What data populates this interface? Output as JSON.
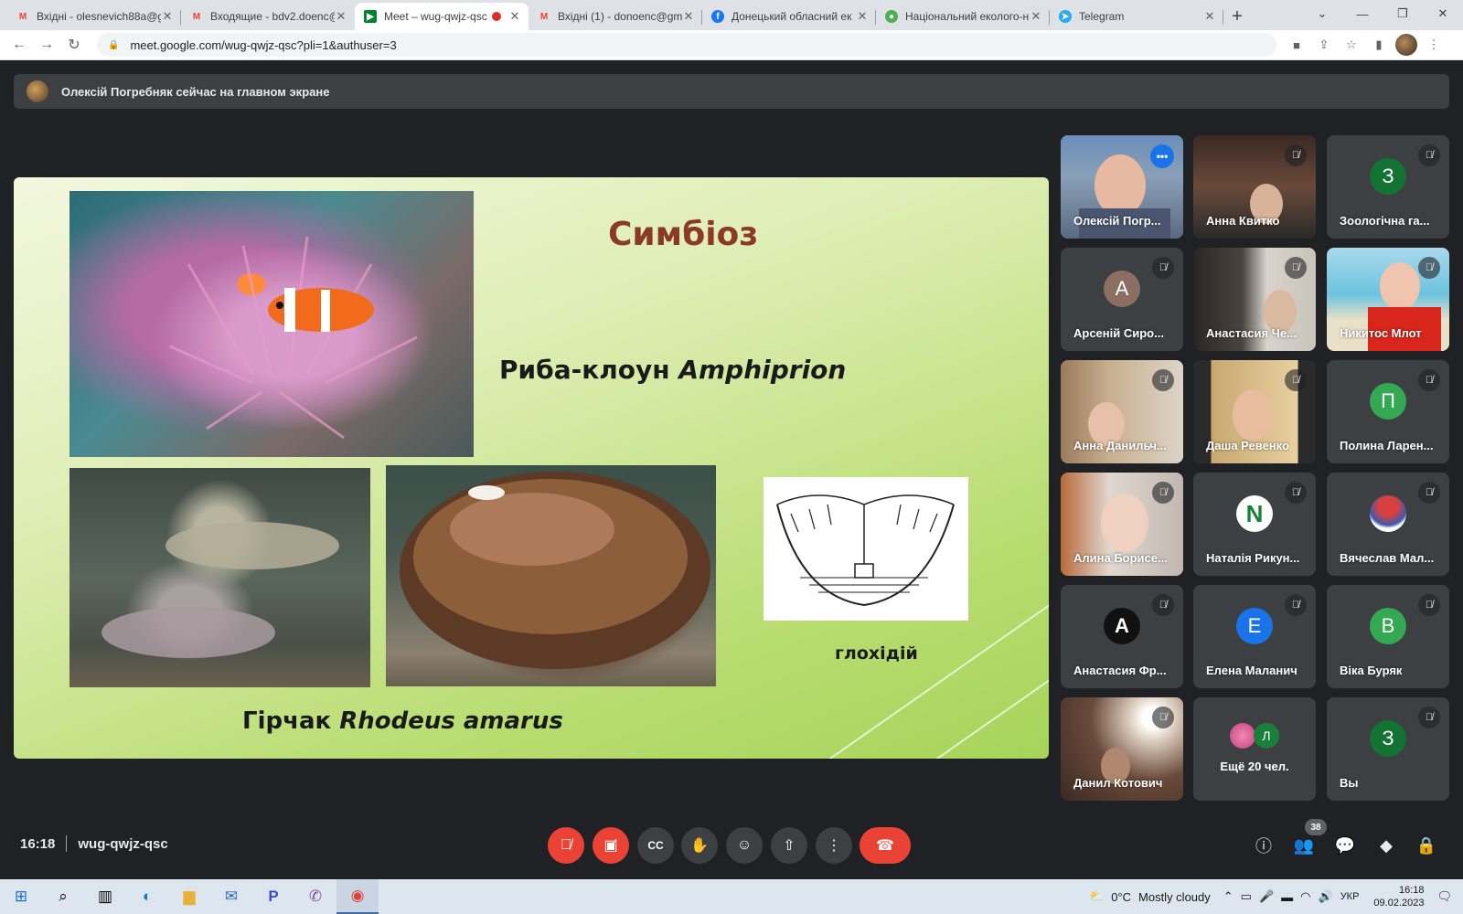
{
  "browser": {
    "tabs": [
      {
        "title": "Вхідні - olesnevich88a@g",
        "icon": "gmail-icon",
        "active": false
      },
      {
        "title": "Входящие - bdv2.doenc@",
        "icon": "gmail-icon",
        "active": false
      },
      {
        "title": "Meet – wug-qwjz-qsc",
        "icon": "meet-icon",
        "active": true
      },
      {
        "title": "Вхідні (1) - donoenc@gm",
        "icon": "gmail-icon",
        "active": false
      },
      {
        "title": "Донецький обласний ек",
        "icon": "facebook-icon",
        "active": false
      },
      {
        "title": "Національний еколого-н",
        "icon": "site-icon",
        "active": false
      },
      {
        "title": "Telegram",
        "icon": "telegram-icon",
        "active": false
      }
    ],
    "url": "meet.google.com/wug-qwjz-qsc?pli=1&authuser=3"
  },
  "meet": {
    "banner": "Олексій Погребняк сейчас на главном экране",
    "slide": {
      "title": "Симбіоз",
      "caption_top_prefix": "Риба-клоун ",
      "caption_top_italic": "Amphiprion",
      "caption_bottom_prefix": "Гірчак ",
      "caption_bottom_italic": "Rhodeus amarus",
      "caption_small": "глохідій"
    },
    "participants": [
      {
        "name": "Олексій Погр...",
        "type": "video",
        "speaking": true
      },
      {
        "name": "Анна Квитко",
        "type": "video",
        "muted": true
      },
      {
        "name": "Зоологічна га...",
        "type": "letter",
        "letter": "З",
        "color": "#137333",
        "muted": true
      },
      {
        "name": "Арсеній Сиро...",
        "type": "letter",
        "letter": "А",
        "color": "#8d6e63",
        "muted": true
      },
      {
        "name": "Анастасия Че...",
        "type": "video",
        "muted": true
      },
      {
        "name": "Никитос Млот",
        "type": "video",
        "muted": true
      },
      {
        "name": "Анна Данильч...",
        "type": "video",
        "muted": true
      },
      {
        "name": "Даша Ревенко",
        "type": "video",
        "muted": true
      },
      {
        "name": "Полина Ларен...",
        "type": "letter",
        "letter": "П",
        "color": "#34a853",
        "muted": true
      },
      {
        "name": "Алина Борисе...",
        "type": "video",
        "muted": true
      },
      {
        "name": "Наталія Рикун...",
        "type": "logo",
        "letter": "N",
        "muted": true
      },
      {
        "name": "Вячеслав Мал...",
        "type": "photo",
        "muted": true
      },
      {
        "name": "Анастасия Фр...",
        "type": "logo-a",
        "letter": "A",
        "muted": true
      },
      {
        "name": "Елена Маланич",
        "type": "letter",
        "letter": "Е",
        "color": "#1a73e8",
        "muted": true
      },
      {
        "name": "Віка Буряк",
        "type": "letter",
        "letter": "В",
        "color": "#34a853",
        "muted": true
      },
      {
        "name": "Данил Котович",
        "type": "video",
        "muted": true
      },
      {
        "name": "Ещё 20 чел.",
        "type": "more",
        "letter": "Л"
      },
      {
        "name": "Вы",
        "type": "letter",
        "letter": "З",
        "color": "#137333",
        "muted": true
      }
    ],
    "bottom": {
      "time": "16:18",
      "meeting_code": "wug-qwjz-qsc",
      "participants_count": "38"
    }
  },
  "taskbar": {
    "weather": "0°C",
    "weather_desc": "Mostly cloudy",
    "lang": "УКР",
    "clock_time": "16:18",
    "clock_date": "09.02.2023"
  }
}
